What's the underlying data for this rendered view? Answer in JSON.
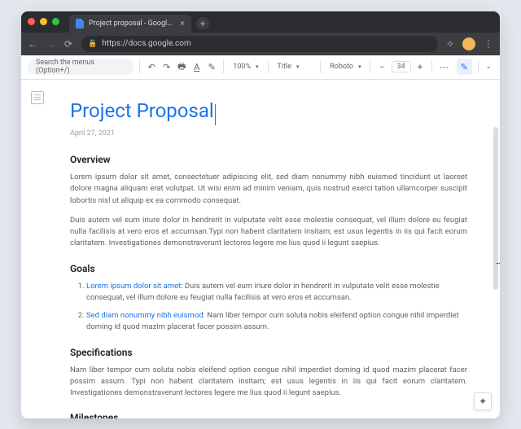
{
  "browser": {
    "tab_title": "Project proposal - Google Do",
    "url": "https://docs.google.com"
  },
  "toolbar": {
    "search_placeholder": "Search the menus (Option+/)",
    "zoom": "100%",
    "style": "Title",
    "font": "Roboto",
    "font_size": "34"
  },
  "document": {
    "title": "Project Proposal",
    "date": "April 27, 2021",
    "sections": {
      "overview": {
        "heading": "Overview",
        "p1": "Lorem ipsum dolor sit amet, consectetuer adipiscing elit, sed diam nonummy nibh euismod tincidunt ut laoreet dolore magna aliquam erat volutpat. Ut wisi enim ad minim veniam, quis nostrud exerci tation ullamcorper suscipit lobortis nisl ut aliquip ex ea commodo consequat.",
        "p2": "Duis autem vel eum iriure dolor in hendrerit in vulputate velit esse molestie consequat, vel illum dolore eu feugiat nulla facilisis at vero eros et accumsan.Typi non habent claritatem insitam; est usus legentis in iis qui facit eorum claritatem. Investigationes demonstraverunt lectores legere me lius quod ii legunt saepius."
      },
      "goals": {
        "heading": "Goals",
        "items": [
          {
            "lead": "Lorem ipsum dolor sit amet:",
            "rest": " Duis autem vel eum iriure dolor in hendrerit in vulputate velit esse molestie consequat, vel illum dolore eu feugiat nulla facilisis at vero eros et accumsan."
          },
          {
            "lead": "Sed diam nonummy nibh euismod:",
            "rest": " Nam liber tempor cum soluta nobis eleifend option congue nihil imperdiet doming id quod mazim placerat facer possim assum."
          }
        ]
      },
      "specifications": {
        "heading": "Specifications",
        "p1": "Nam liber tempor cum soluta nobis eleifend option congue nihil imperdiet doming id quod mazim placerat facer possim assum. Typi non habent claritatem insitam; est usus legentis in iis qui facit eorum claritatem. Investigationes demonstraverunt lectores legere me lius quod ii legunt saepius."
      },
      "milestones": {
        "heading": "Milestones"
      }
    }
  }
}
